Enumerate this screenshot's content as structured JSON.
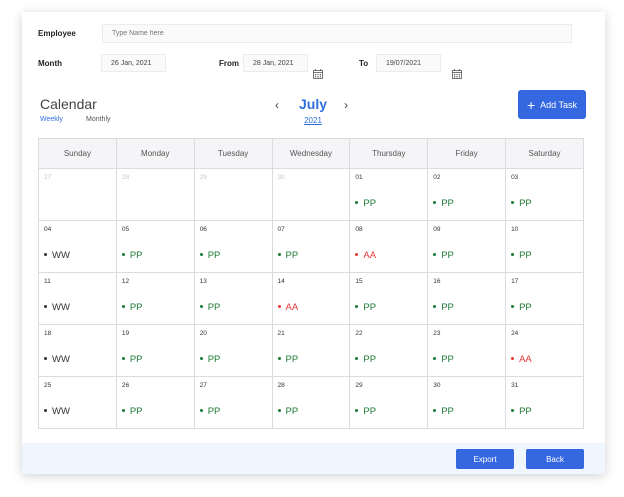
{
  "employee": {
    "label": "Employee",
    "placeholder": "Type Name here"
  },
  "month_field": {
    "label": "Month",
    "value": "26 Jan, 2021"
  },
  "from_field": {
    "label": "From",
    "value": "28 Jan, 2021"
  },
  "to_field": {
    "label": "To",
    "value": "19/07/2021"
  },
  "calendar": {
    "title": "Calendar",
    "views": {
      "weekly": "Weekly",
      "monthly": "Monthly"
    },
    "prev": "‹",
    "next": "›",
    "month": "July",
    "year": "2021",
    "add_task_label": "Add Task",
    "weekdays": [
      "Sunday",
      "Monday",
      "Tuesday",
      "Wednesday",
      "Thursday",
      "Friday",
      "Saturday"
    ],
    "weeks": [
      [
        {
          "day": "27",
          "muted": true,
          "status": ""
        },
        {
          "day": "28",
          "muted": true,
          "status": ""
        },
        {
          "day": "29",
          "muted": true,
          "status": ""
        },
        {
          "day": "30",
          "muted": true,
          "status": ""
        },
        {
          "day": "01",
          "status": "PP"
        },
        {
          "day": "02",
          "status": "PP"
        },
        {
          "day": "03",
          "status": "PP"
        }
      ],
      [
        {
          "day": "04",
          "status": "WW"
        },
        {
          "day": "05",
          "status": "PP"
        },
        {
          "day": "06",
          "status": "PP"
        },
        {
          "day": "07",
          "status": "PP"
        },
        {
          "day": "08",
          "status": "AA"
        },
        {
          "day": "09",
          "status": "PP"
        },
        {
          "day": "10",
          "status": "PP"
        }
      ],
      [
        {
          "day": "11",
          "status": "WW"
        },
        {
          "day": "12",
          "status": "PP"
        },
        {
          "day": "13",
          "status": "PP"
        },
        {
          "day": "14",
          "status": "AA"
        },
        {
          "day": "15",
          "status": "PP"
        },
        {
          "day": "16",
          "status": "PP"
        },
        {
          "day": "17",
          "status": "PP"
        }
      ],
      [
        {
          "day": "18",
          "status": "WW"
        },
        {
          "day": "19",
          "status": "PP"
        },
        {
          "day": "20",
          "status": "PP"
        },
        {
          "day": "21",
          "status": "PP"
        },
        {
          "day": "22",
          "status": "PP"
        },
        {
          "day": "23",
          "status": "PP"
        },
        {
          "day": "24",
          "status": "AA"
        }
      ],
      [
        {
          "day": "25",
          "status": "WW"
        },
        {
          "day": "26",
          "status": "PP"
        },
        {
          "day": "27",
          "status": "PP"
        },
        {
          "day": "28",
          "status": "PP"
        },
        {
          "day": "29",
          "status": "PP"
        },
        {
          "day": "30",
          "status": "PP"
        },
        {
          "day": "31",
          "status": "PP"
        }
      ]
    ]
  },
  "status_colors": {
    "PP": "#1e7b34",
    "AA": "#e53935",
    "WW": "#333333"
  },
  "footer": {
    "export_label": "Export",
    "back_label": "Back"
  }
}
